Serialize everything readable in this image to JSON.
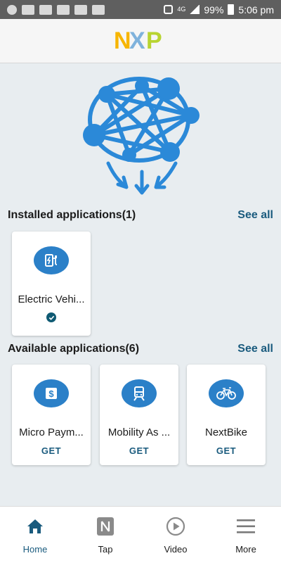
{
  "status_bar": {
    "network": "4G",
    "battery": "99%",
    "time": "5:06 pm"
  },
  "app_bar": {
    "logo": "NXP"
  },
  "installed": {
    "title": "Installed applications(1)",
    "see_all": "See all",
    "apps": [
      {
        "name": "Electric Vehi...",
        "icon": "ev-charger-icon",
        "status": "installed"
      }
    ]
  },
  "available": {
    "title": "Available applications(6)",
    "see_all": "See all",
    "apps": [
      {
        "name": "Micro Paym...",
        "icon": "payment-icon",
        "action": "GET"
      },
      {
        "name": "Mobility As ...",
        "icon": "train-icon",
        "action": "GET"
      },
      {
        "name": "NextBike",
        "icon": "bike-icon",
        "action": "GET"
      }
    ]
  },
  "bottom_nav": {
    "items": [
      {
        "label": "Home",
        "icon": "home-icon",
        "active": true
      },
      {
        "label": "Tap",
        "icon": "nfc-icon",
        "active": false
      },
      {
        "label": "Video",
        "icon": "play-icon",
        "active": false
      },
      {
        "label": "More",
        "icon": "menu-icon",
        "active": false
      }
    ]
  },
  "colors": {
    "accent": "#1a5b7e",
    "app_icon_bg": "#2b80c8",
    "background": "#e8edf0",
    "status_bar": "#5f5f5f"
  }
}
